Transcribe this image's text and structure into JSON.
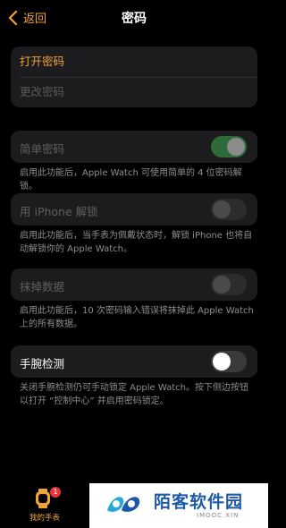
{
  "nav": {
    "back_label": "返回",
    "title": "密码"
  },
  "passcode": {
    "turn_on": "打开密码",
    "change": "更改密码"
  },
  "settings": [
    {
      "label": "简单密码",
      "on": true,
      "enabled": false,
      "note": "启用此功能后，Apple Watch 可使用简单的 4 位密码解锁。"
    },
    {
      "label": "用 iPhone 解锁",
      "on": false,
      "enabled": false,
      "note": "启用此功能后，当手表为佩戴状态时，解锁 iPhone 也将自动解锁你的 Apple Watch。"
    },
    {
      "label": "抹掉数据",
      "on": false,
      "enabled": false,
      "note": "启用此功能后，10 次密码输入错误将抹掉此 Apple Watch 上的所有数据。"
    },
    {
      "label": "手腕检测",
      "on": false,
      "enabled": true,
      "note": "关闭手腕检测仍可手动锁定 Apple Watch。按下侧边按钮以打开 “控制中心” 并启用密码锁定。"
    }
  ],
  "tabbar": {
    "label": "我的手表",
    "badge": "1"
  },
  "watermark": {
    "title": "陌客软件园",
    "url": "IMOOC.XIN"
  },
  "colors": {
    "accent": "#f1a33b",
    "toggle_on": "#2e6b3a",
    "badge": "#e5353b",
    "background": "#000000",
    "cell": "#1c1c1e"
  }
}
